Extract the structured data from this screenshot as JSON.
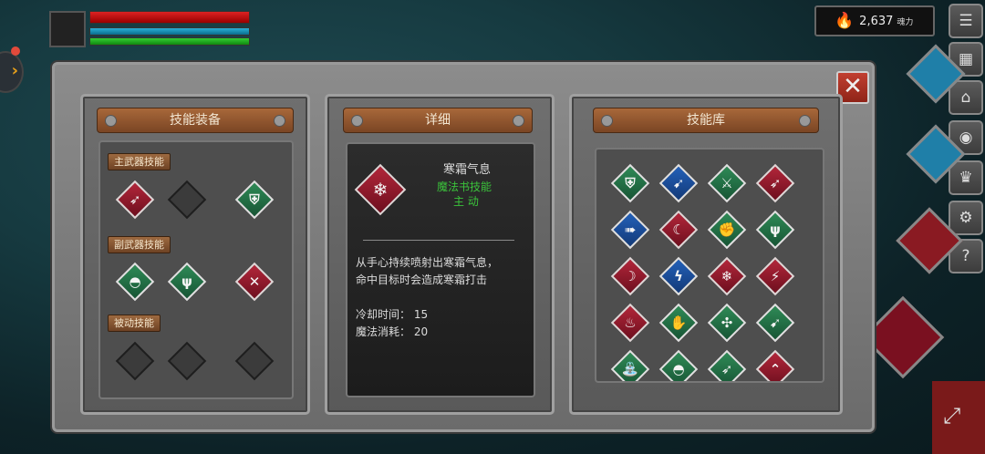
{
  "hud": {
    "hp_fill": 1.0,
    "mp_fill": 1.0,
    "sp_fill": 1.0
  },
  "currency": {
    "value": "2,637",
    "unit": "魂力",
    "icon": "flame-icon"
  },
  "right_buttons": [
    {
      "name": "menu-list-icon",
      "glyph": "☰"
    },
    {
      "name": "scroll-icon",
      "glyph": "▦"
    },
    {
      "name": "door-icon",
      "glyph": "⌂"
    },
    {
      "name": "emblem-icon",
      "glyph": "◉"
    },
    {
      "name": "crown-icon",
      "glyph": "♛"
    },
    {
      "name": "settings-gear-icon",
      "glyph": "⚙"
    },
    {
      "name": "help-icon",
      "glyph": "?"
    }
  ],
  "panels": {
    "equip": {
      "title": "技能装备"
    },
    "detail": {
      "title": "详细"
    },
    "library": {
      "title": "技能库"
    }
  },
  "equip": {
    "main_weapon_label": "主武器技能",
    "sub_weapon_label": "副武器技能",
    "passive_label": "被动技能"
  },
  "detail": {
    "skill_name": "寒霜气息",
    "skill_type": "魔法书技能",
    "skill_mode": "主 动",
    "desc_line1": "从手心持续喷射出寒霜气息，",
    "desc_line2": "命中目标时会造成寒霜打击",
    "cooldown": "冷却时间： 15",
    "mana": "魔法消耗： 20"
  },
  "colors": {
    "hp": "#cc2222",
    "mp": "#1a9cc8",
    "sp": "#2aa82a",
    "accent_green": "#3bc33b",
    "close_red": "#b13425"
  }
}
